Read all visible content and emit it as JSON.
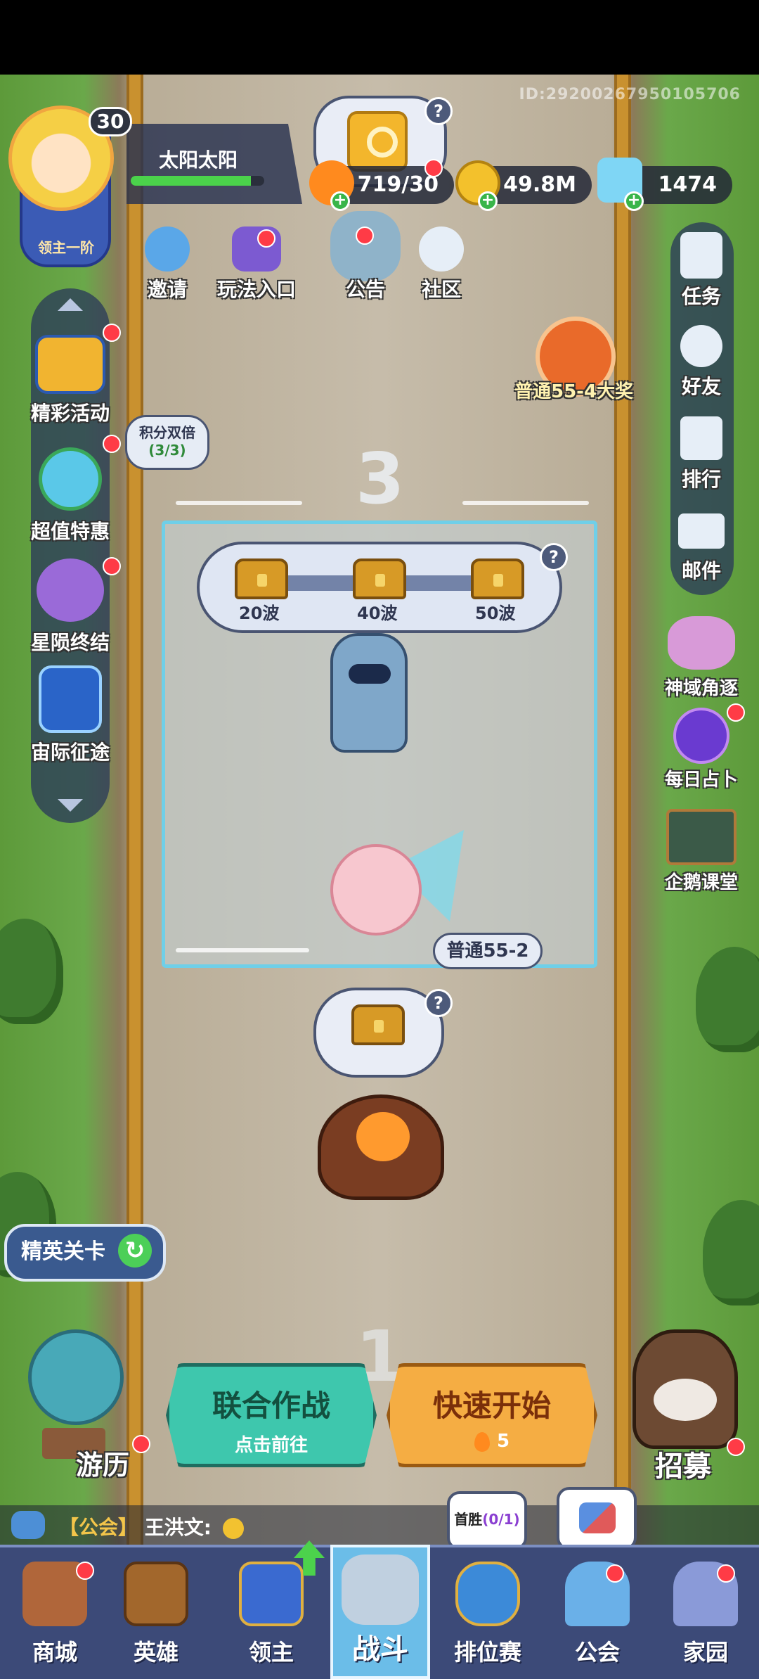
{
  "player": {
    "level": "30",
    "name": "太阳太阳",
    "rank_title": "领主一阶",
    "uid": "ID:29200267950105706",
    "xp_fraction": 0.9
  },
  "currency": {
    "stamina": "719/30",
    "gold": "49.8M",
    "gems": "1474"
  },
  "top_actions": {
    "invite": "邀请",
    "gameplay_entry": "玩法入口",
    "notice": "公告",
    "community": "社区"
  },
  "left_menu": {
    "events": "精彩活动",
    "double_points_title": "积分双倍",
    "double_points_count": "(3/3)",
    "value_deals": "超值特惠",
    "star_end": "星陨终结",
    "interstellar": "宙际征途"
  },
  "right_menu": {
    "tasks": "任务",
    "friends": "好友",
    "ranking": "排行",
    "mail": "邮件",
    "divine_realm": "神域角逐",
    "daily_fortune": "每日占卜",
    "penguin_class": "企鹅课堂"
  },
  "stage_reward": {
    "label": "普通55-4大奖"
  },
  "arena": {
    "wave_top": "3",
    "wave_bottom": "1",
    "rewards": [
      "20波",
      "40波",
      "50波"
    ],
    "current_stage": "普通55-2"
  },
  "elite_stage": "精英关卡",
  "travel": "游历",
  "buttons": {
    "coop_title": "联合作战",
    "coop_sub": "点击前往",
    "quick_title": "快速开始",
    "quick_cost": "5"
  },
  "recruit": "招募",
  "chat": {
    "channel": "【公会】",
    "user": "王洪文:"
  },
  "first_win": {
    "label": "首胜",
    "count": "(0/1)"
  },
  "nav": {
    "shop": "商城",
    "heroes": "英雄",
    "lord": "领主",
    "battle": "战斗",
    "ranked": "排位赛",
    "guild": "公会",
    "home": "家园"
  },
  "colors": {
    "accent_blue": "#6bbde8",
    "coop_green": "#3ec7ad",
    "quick_orange": "#f5ad43",
    "notify_red": "#ff3b46"
  }
}
